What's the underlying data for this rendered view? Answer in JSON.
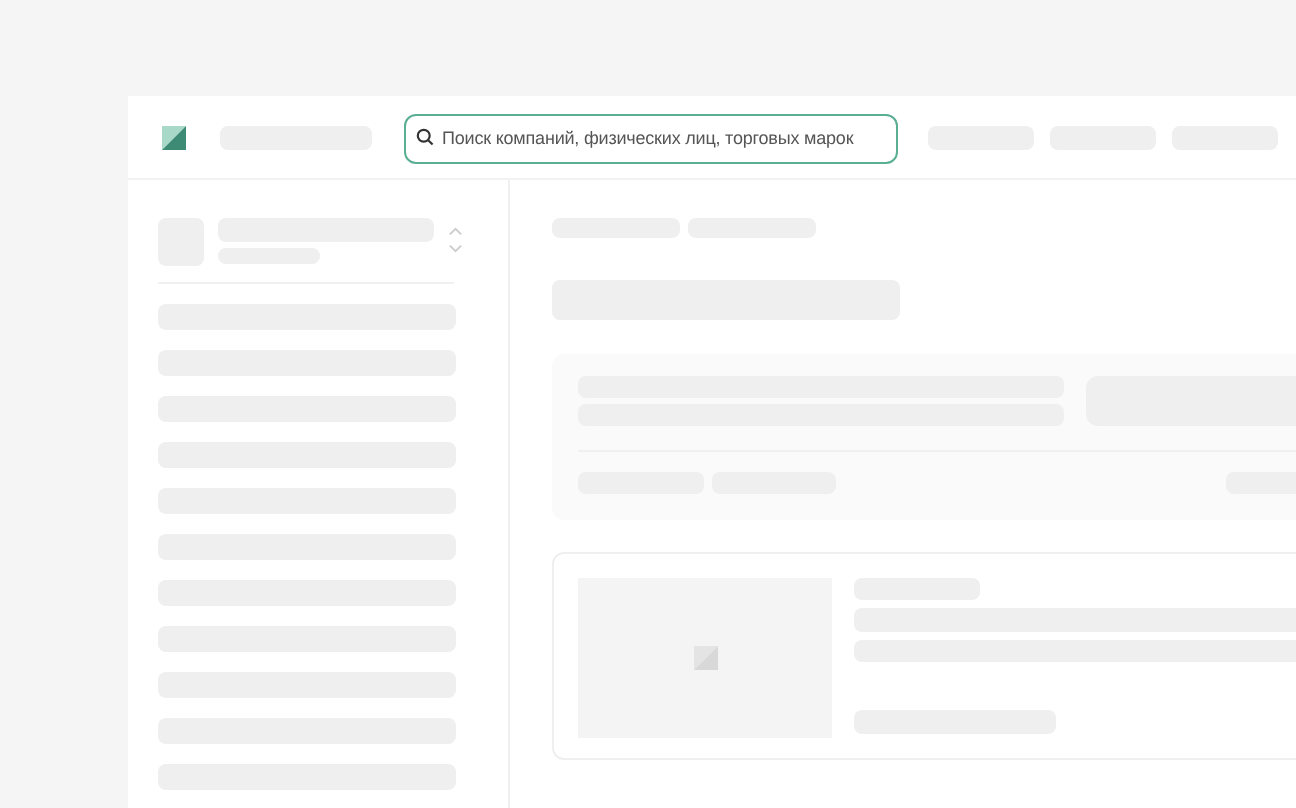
{
  "search": {
    "placeholder": "Поиск компаний, физических лиц, торговых марок"
  }
}
